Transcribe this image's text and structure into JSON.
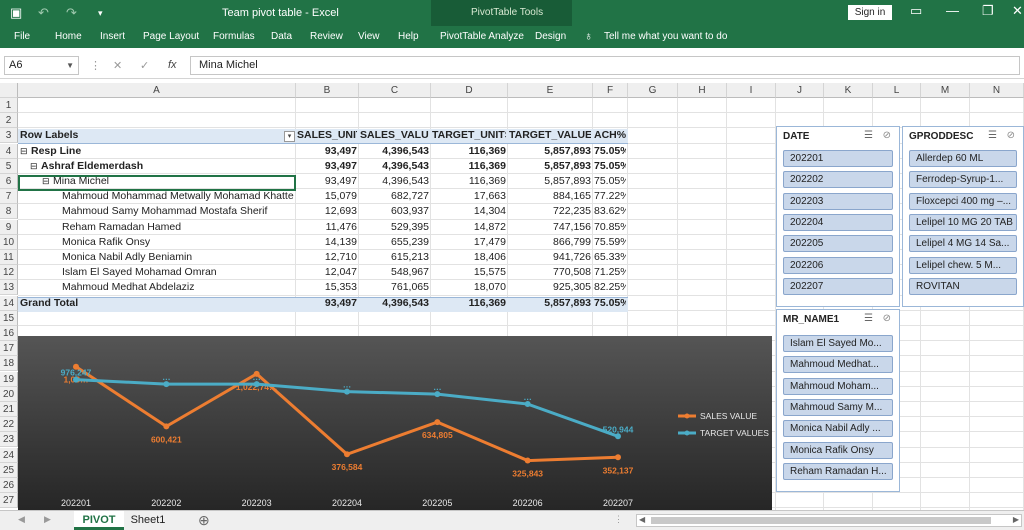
{
  "window": {
    "title": "Team pivot table  -  Excel",
    "context_tools": "PivotTable Tools",
    "signin": "Sign in",
    "save_icon": "save-icon",
    "undo_icon": "undo-icon",
    "redo_icon": "redo-icon"
  },
  "ribbon": {
    "tabs": [
      "File",
      "Home",
      "Insert",
      "Page Layout",
      "Formulas",
      "Data",
      "Review",
      "View",
      "Help",
      "PivotTable Analyze",
      "Design"
    ],
    "tell_me": "Tell me what you want to do"
  },
  "formula_bar": {
    "name_box": "A6",
    "fx": "fx",
    "value": "Mina Michel"
  },
  "columns": [
    "A",
    "B",
    "C",
    "D",
    "E",
    "F",
    "G",
    "H",
    "I",
    "J",
    "K",
    "L",
    "M",
    "N"
  ],
  "rows": [
    "1",
    "2",
    "3",
    "4",
    "5",
    "6",
    "7",
    "8",
    "9",
    "10",
    "11",
    "12",
    "13",
    "14",
    "15",
    "16",
    "17",
    "18",
    "19",
    "20",
    "21",
    "22",
    "23",
    "24",
    "25",
    "26",
    "27"
  ],
  "pivot": {
    "headers": [
      "Row Labels",
      "SALES_UNIT.",
      "SALES_VALUE.",
      "TARGET_UNITS.",
      "TARGET_VALUES.",
      "ACH%."
    ],
    "rows": [
      {
        "label": "Resp Line",
        "prefix": "⊟",
        "level": 0,
        "bold": true,
        "values": [
          "93,497",
          "4,396,543",
          "116,369",
          "5,857,893",
          "75.05%"
        ]
      },
      {
        "label": "Ashraf Eldemerdash",
        "prefix": "⊟",
        "level": 1,
        "bold": true,
        "values": [
          "93,497",
          "4,396,543",
          "116,369",
          "5,857,893",
          "75.05%"
        ]
      },
      {
        "label": "Mina Michel",
        "prefix": "⊟",
        "level": 2,
        "bold": false,
        "values": [
          "93,497",
          "4,396,543",
          "116,369",
          "5,857,893",
          "75.05%"
        ]
      },
      {
        "label": "Mahmoud Mohammad Metwally Mohamad Khatte",
        "prefix": "",
        "level": 3,
        "bold": false,
        "values": [
          "15,079",
          "682,727",
          "17,663",
          "884,165",
          "77.22%"
        ]
      },
      {
        "label": "Mahmoud Samy Mohammad Mostafa Sherif",
        "prefix": "",
        "level": 3,
        "bold": false,
        "values": [
          "12,693",
          "603,937",
          "14,304",
          "722,235",
          "83.62%"
        ]
      },
      {
        "label": "Reham Ramadan Hamed",
        "prefix": "",
        "level": 3,
        "bold": false,
        "values": [
          "11,476",
          "529,395",
          "14,872",
          "747,156",
          "70.85%"
        ]
      },
      {
        "label": "Monica Rafik Onsy",
        "prefix": "",
        "level": 3,
        "bold": false,
        "values": [
          "14,139",
          "655,239",
          "17,479",
          "866,799",
          "75.59%"
        ]
      },
      {
        "label": "Monica Nabil Adly Beniamin",
        "prefix": "",
        "level": 3,
        "bold": false,
        "values": [
          "12,710",
          "615,213",
          "18,406",
          "941,726",
          "65.33%"
        ]
      },
      {
        "label": "Islam El Sayed Mohamad Omran",
        "prefix": "",
        "level": 3,
        "bold": false,
        "values": [
          "12,047",
          "548,967",
          "15,575",
          "770,508",
          "71.25%"
        ]
      },
      {
        "label": "Mahmoud Medhat Abdelaziz",
        "prefix": "",
        "level": 3,
        "bold": false,
        "values": [
          "15,353",
          "761,065",
          "18,070",
          "925,305",
          "82.25%"
        ]
      }
    ],
    "grand_total": {
      "label": "Grand Total",
      "values": [
        "93,497",
        "4,396,543",
        "116,369",
        "5,857,893",
        "75.05%"
      ]
    }
  },
  "chart_data": {
    "type": "line",
    "categories": [
      "202201",
      "202202",
      "202203",
      "202204",
      "202205",
      "202206",
      "202207"
    ],
    "series": [
      {
        "name": "SALES VALUE",
        "color": "#ed7d31",
        "values": [
          1080000,
          600421,
          1022740,
          376584,
          634805,
          325843,
          352137
        ],
        "labels": [
          "1,08…",
          "600,421",
          "1,022,74…",
          "376,584",
          "634,805",
          "325,843",
          "352,137"
        ]
      },
      {
        "name": "TARGET VALUES",
        "color": "#4bacc6",
        "values": [
          976247,
          940000,
          940000,
          880000,
          860000,
          780000,
          520944
        ],
        "labels": [
          "976,247",
          "…",
          "…",
          "…",
          "…",
          "…",
          "520,944"
        ]
      }
    ],
    "ylim": [
      250000,
      1150000
    ],
    "grid": false,
    "legend": "right"
  },
  "slicers": {
    "date": {
      "title": "DATE",
      "items": [
        "202201",
        "202202",
        "202203",
        "202204",
        "202205",
        "202206",
        "202207"
      ]
    },
    "gproddesc": {
      "title": "GPRODDESC",
      "items": [
        "Allerdep 60 ML",
        "Ferrodep-Syrup-1...",
        "Floxcepci 400 mg –...",
        "Lelipel 10 MG 20 TAB",
        "Lelipel 4 MG 14 Sa...",
        "Lelipel chew. 5 M...",
        "ROVITAN"
      ]
    },
    "mr_name": {
      "title": "MR_NAME1",
      "items": [
        "Islam El Sayed Mo...",
        "Mahmoud Medhat...",
        "Mahmoud Moham...",
        "Mahmoud Samy M...",
        "Monica Nabil Adly ...",
        "Monica Rafik Onsy",
        "Reham Ramadan H..."
      ]
    }
  },
  "sheets": {
    "tabs": [
      "PIVOT",
      "Sheet1"
    ],
    "active": "PIVOT",
    "add_icon": "plus-icon"
  }
}
